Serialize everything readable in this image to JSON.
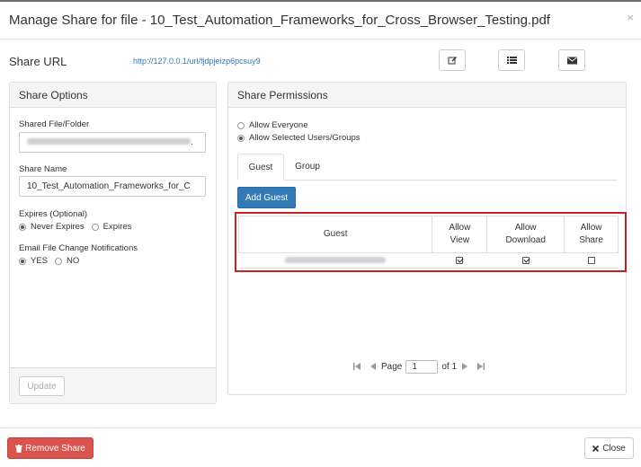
{
  "modal": {
    "title": "Manage Share for file - 10_Test_Automation_Frameworks_for_Cross_Browser_Testing.pdf",
    "close_glyph": "×"
  },
  "share_url": {
    "label": "Share URL",
    "url": "http://127.0.0.1/url/fjdpjeizp6pcsuy9"
  },
  "toolbar_icons": [
    "edit-icon",
    "list-icon",
    "envelope-icon"
  ],
  "share_options": {
    "heading": "Share Options",
    "shared_file_label": "Shared File/Folder",
    "shared_file_value_end": ".",
    "share_name_label": "Share Name",
    "share_name_value": "10_Test_Automation_Frameworks_for_C",
    "expires_label": "Expires (Optional)",
    "expires_options": [
      "Never Expires",
      "Expires"
    ],
    "expires_selected": "Never Expires",
    "notify_label": "Email File Change Notifications",
    "notify_options": [
      "YES",
      "NO"
    ],
    "notify_selected": "YES",
    "update_button": "Update"
  },
  "share_permissions": {
    "heading": "Share Permissions",
    "access_options": [
      "Allow Everyone",
      "Allow Selected Users/Groups"
    ],
    "access_selected": "Allow Selected Users/Groups",
    "tabs": [
      "Guest",
      "Group"
    ],
    "active_tab": "Guest",
    "add_guest_button": "Add Guest",
    "table": {
      "columns": [
        "Guest",
        "Allow View",
        "Allow Download",
        "Allow Share"
      ],
      "rows": [
        {
          "allow_view": true,
          "allow_download": true,
          "allow_share": false
        }
      ]
    },
    "pager": {
      "page_label": "Page",
      "page_value": "1",
      "of_label": "of 1"
    }
  },
  "footer": {
    "remove_share_button": "Remove Share",
    "close_button": "Close"
  },
  "colors": {
    "primary": "#337ab7",
    "danger": "#d9534f",
    "highlight": "#cc1f1f"
  }
}
